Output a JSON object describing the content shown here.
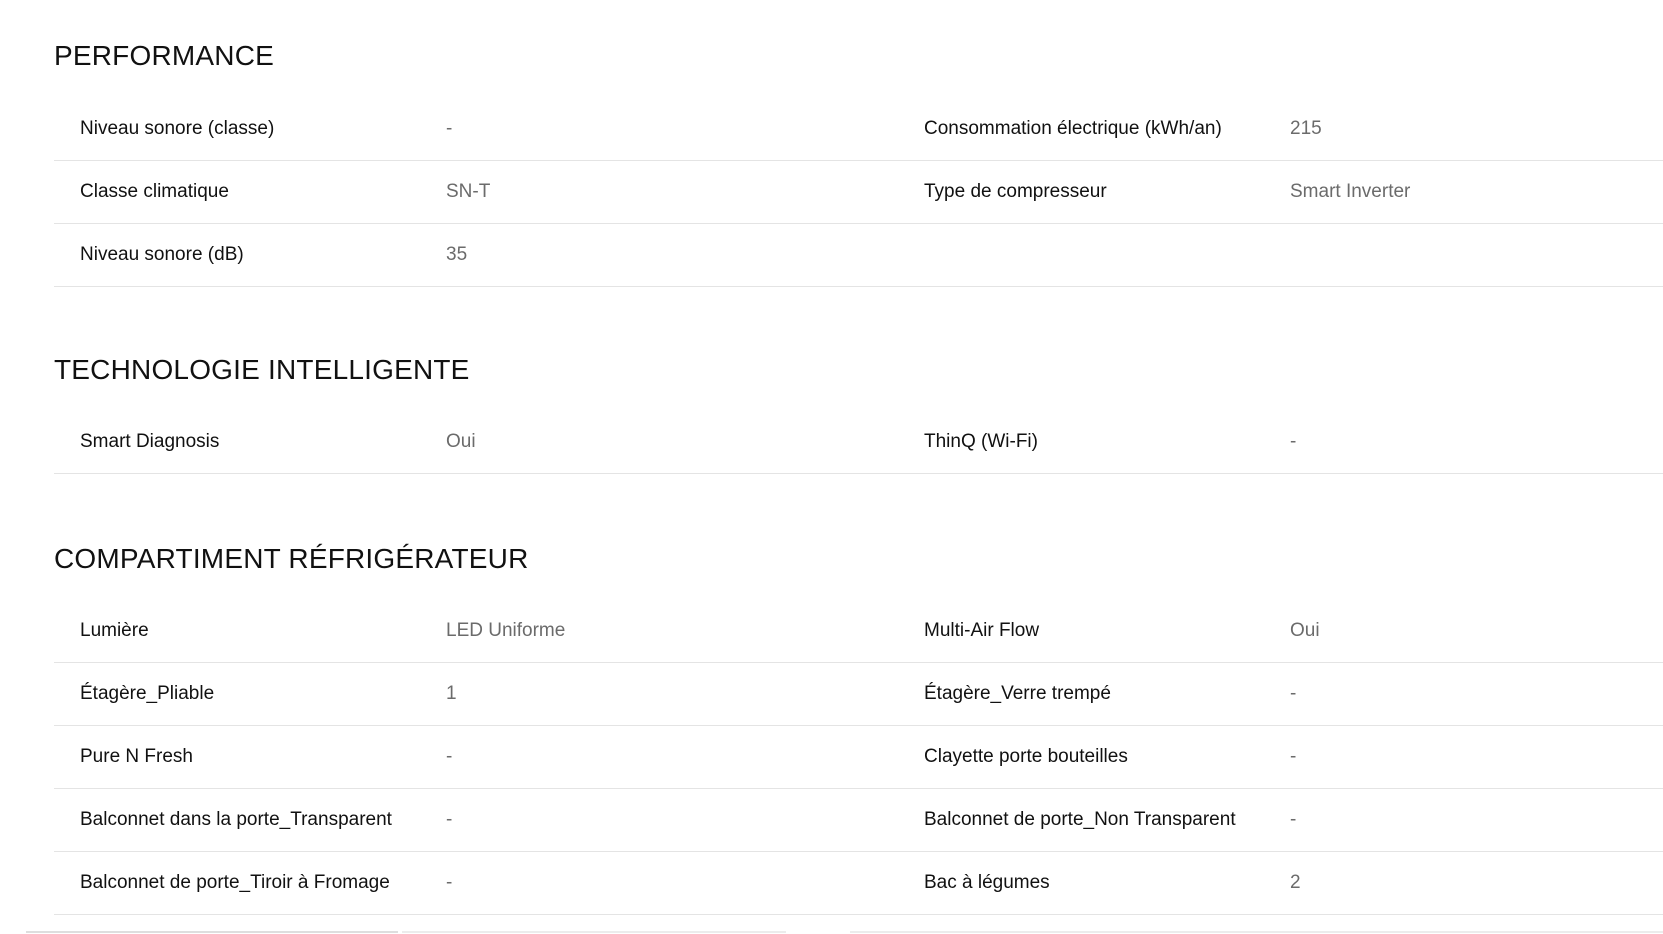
{
  "sections": [
    {
      "title": "PERFORMANCE",
      "rows": [
        [
          {
            "label": "Niveau sonore (classe)",
            "value": "-"
          },
          {
            "label": "Consommation électrique (kWh/an)",
            "value": "215"
          }
        ],
        [
          {
            "label": "Classe climatique",
            "value": "SN-T"
          },
          {
            "label": "Type de compresseur",
            "value": "Smart Inverter"
          }
        ],
        [
          {
            "label": "Niveau sonore (dB)",
            "value": "35"
          },
          {
            "label": "",
            "value": ""
          }
        ]
      ]
    },
    {
      "title": "TECHNOLOGIE INTELLIGENTE",
      "rows": [
        [
          {
            "label": "Smart Diagnosis",
            "value": "Oui"
          },
          {
            "label": "ThinQ (Wi-Fi)",
            "value": "-"
          }
        ]
      ]
    },
    {
      "title": "COMPARTIMENT RÉFRIGÉRATEUR",
      "rows": [
        [
          {
            "label": "Lumière",
            "value": "LED Uniforme"
          },
          {
            "label": "Multi-Air Flow",
            "value": "Oui"
          }
        ],
        [
          {
            "label": "Étagère_Pliable",
            "value": "1"
          },
          {
            "label": "Étagère_Verre trempé",
            "value": "-"
          }
        ],
        [
          {
            "label": "Pure N Fresh",
            "value": "-"
          },
          {
            "label": "Clayette porte bouteilles",
            "value": "-"
          }
        ],
        [
          {
            "label": "Balconnet dans la porte_Transparent",
            "value": "-"
          },
          {
            "label": "Balconnet de porte_Non Transparent",
            "value": "-"
          }
        ],
        [
          {
            "label": "Balconnet de porte_Tiroir à Fromage",
            "value": "-"
          },
          {
            "label": "Bac à légumes",
            "value": "2"
          }
        ]
      ]
    }
  ]
}
